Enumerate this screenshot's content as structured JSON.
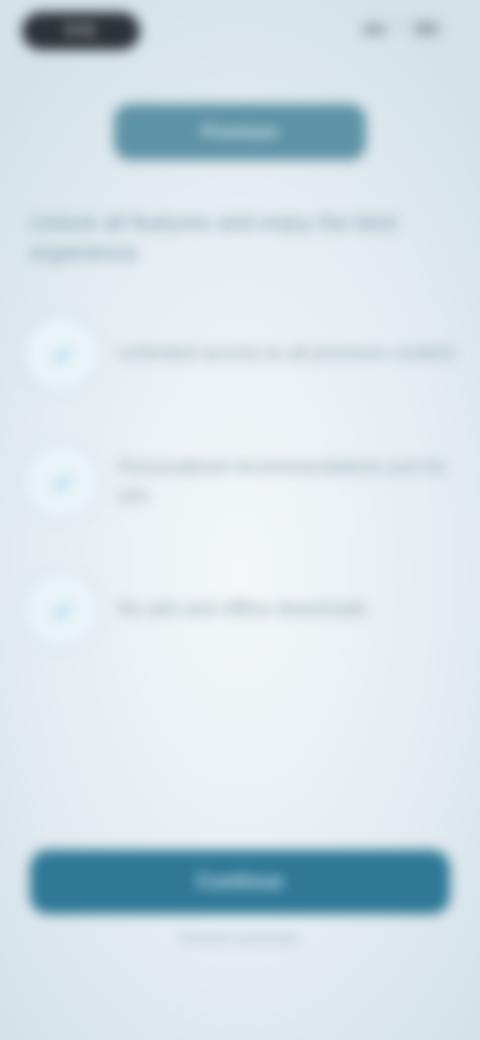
{
  "status_bar": {
    "time": "9:41",
    "signal": "▮▮▮",
    "wifi": "◠"
  },
  "header": {
    "title": "Premium"
  },
  "headline": "Unlock all features and enjoy the best experience",
  "features": [
    {
      "text": "Unlimited access to all premium content",
      "icon": "check-icon"
    },
    {
      "text": "Personalized recommendations just for you",
      "icon": "check-icon"
    },
    {
      "text": "No ads and offline downloads",
      "icon": "check-icon"
    }
  ],
  "cta": {
    "label": "Continue"
  },
  "secondary": {
    "label": "Restore purchase"
  },
  "colors": {
    "accent": "#2f7896",
    "header": "#5d93a6",
    "check": "#8cc8e2"
  }
}
